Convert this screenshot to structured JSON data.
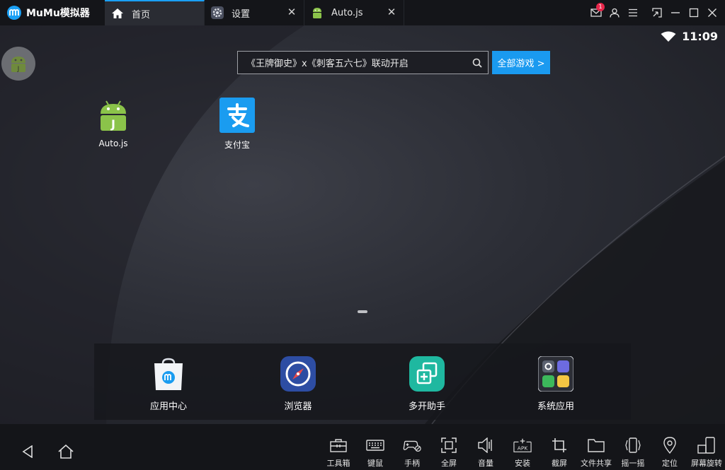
{
  "app": {
    "name": "MuMu模拟器"
  },
  "tabs": [
    {
      "label": "首页",
      "icon": "home-icon",
      "active": true
    },
    {
      "label": "设置",
      "icon": "gear-icon",
      "active": false
    },
    {
      "label": "Auto.js",
      "icon": "android-icon",
      "active": false
    }
  ],
  "window": {
    "mail_badge": "1"
  },
  "status_bar": {
    "time": "11:09"
  },
  "search": {
    "text": "《王牌御史》x《刺客五六七》联动开启",
    "button": "全部游戏 >"
  },
  "home_apps": [
    {
      "label": "Auto.js",
      "icon": "android-autojs-icon"
    },
    {
      "label": "支付宝",
      "icon": "alipay-icon"
    }
  ],
  "dock_apps": [
    {
      "label": "应用中心",
      "icon": "app-center-icon"
    },
    {
      "label": "浏览器",
      "icon": "compass-browser-icon"
    },
    {
      "label": "多开助手",
      "icon": "multi-instance-icon"
    },
    {
      "label": "系统应用",
      "icon": "system-apps-folder-icon"
    }
  ],
  "toolbar": [
    {
      "label": "工具箱",
      "icon": "toolbox-icon"
    },
    {
      "label": "键鼠",
      "icon": "keyboard-icon"
    },
    {
      "label": "手柄",
      "icon": "gamepad-icon"
    },
    {
      "label": "全屏",
      "icon": "fullscreen-icon"
    },
    {
      "label": "音量",
      "icon": "volume-icon"
    },
    {
      "label": "安装",
      "icon": "apk-install-icon"
    },
    {
      "label": "截屏",
      "icon": "crop-screenshot-icon"
    },
    {
      "label": "文件共享",
      "icon": "folder-icon"
    },
    {
      "label": "摇一摇",
      "icon": "shake-icon"
    },
    {
      "label": "定位",
      "icon": "location-pin-icon"
    },
    {
      "label": "屏幕旋转",
      "icon": "rotate-screen-icon"
    }
  ],
  "colors": {
    "accent": "#1a9af0",
    "badge": "#e8274b",
    "titlebar": "#141519"
  }
}
